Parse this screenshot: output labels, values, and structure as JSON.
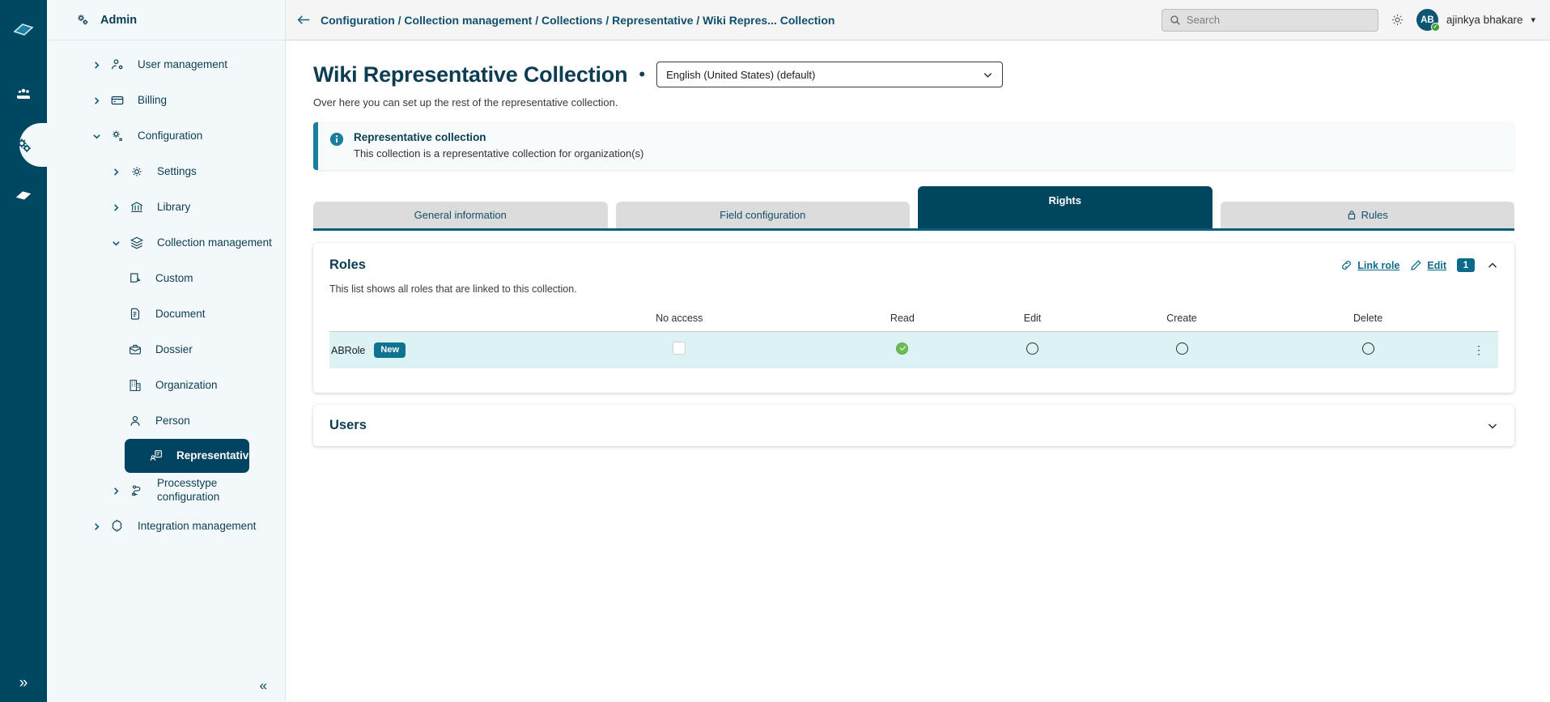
{
  "rail": {
    "logo_icon": "cloud-logo-icon",
    "items": [
      {
        "name": "users-rail-icon",
        "active": false
      },
      {
        "name": "configuration-rail-icon",
        "active": true
      },
      {
        "name": "integration-rail-icon",
        "active": false
      }
    ],
    "expand_icon": "double-chevron-right-icon"
  },
  "sidebar": {
    "title": "Admin",
    "title_icon": "admin-gears-icon",
    "collapse_icon": "double-chevron-left-icon",
    "items": [
      {
        "label": "User management",
        "icon": "user-settings-icon",
        "level": 0,
        "chevron": "right",
        "selected": false
      },
      {
        "label": "Billing",
        "icon": "credit-card-icon",
        "level": 0,
        "chevron": "right",
        "selected": false
      },
      {
        "label": "Configuration",
        "icon": "configuration-gear-icon",
        "level": 0,
        "chevron": "down",
        "selected": false
      },
      {
        "label": "Settings",
        "icon": "gear-icon",
        "level": 1,
        "chevron": "right",
        "selected": false
      },
      {
        "label": "Library",
        "icon": "library-bank-icon",
        "level": 1,
        "chevron": "right",
        "selected": false
      },
      {
        "label": "Collection management",
        "icon": "layers-icon",
        "level": 1,
        "chevron": "down",
        "selected": false
      },
      {
        "label": "Custom",
        "icon": "custom-pencil-page-icon",
        "level": 2,
        "chevron": "none",
        "selected": false
      },
      {
        "label": "Document",
        "icon": "document-icon",
        "level": 2,
        "chevron": "none",
        "selected": false
      },
      {
        "label": "Dossier",
        "icon": "briefcase-icon",
        "level": 2,
        "chevron": "none",
        "selected": false
      },
      {
        "label": "Organization",
        "icon": "building-icon",
        "level": 2,
        "chevron": "none",
        "selected": false
      },
      {
        "label": "Person",
        "icon": "person-icon",
        "level": 2,
        "chevron": "none",
        "selected": false
      },
      {
        "label": "Representative",
        "icon": "representative-icon",
        "level": 2,
        "chevron": "none",
        "selected": true
      },
      {
        "label": "Processtype configuration",
        "icon": "processtype-icon",
        "level": 2,
        "chevron": "right",
        "selected": false
      },
      {
        "label": "Integration management",
        "icon": "puzzle-icon",
        "level": 0,
        "chevron": "right",
        "selected": false
      }
    ]
  },
  "topbar": {
    "back_icon": "back-arrow-icon",
    "breadcrumb": "Configuration / Collection management / Collections / Representative / Wiki Repres... Collection",
    "search": {
      "placeholder": "Search",
      "value": "",
      "icon": "search-icon"
    },
    "gear_icon": "gear-icon",
    "user": {
      "initials": "AB",
      "name": "ajinkya bhakare",
      "status": "online",
      "caret_icon": "chevron-down-icon"
    }
  },
  "page": {
    "title": "Wiki Representative Collection",
    "separator": "•",
    "language": {
      "selected": "English (United States) (default)",
      "caret_icon": "chevron-down-icon"
    },
    "subtitle": "Over here you can set up the rest of the representative collection."
  },
  "banner": {
    "icon": "info-circle-icon",
    "title": "Representative collection",
    "text": "This collection is a representative collection for organization(s)",
    "accent_color": "#1a7f9c"
  },
  "tabs": [
    {
      "label": "General information",
      "active": false,
      "icon": null
    },
    {
      "label": "Field configuration",
      "active": false,
      "icon": null
    },
    {
      "label": "Rights",
      "active": true,
      "icon": null
    },
    {
      "label": "Rules",
      "active": false,
      "icon": "lock-icon"
    }
  ],
  "roles_card": {
    "title": "Roles",
    "description": "This list shows all roles that are linked to this collection.",
    "actions": {
      "link_role": {
        "label": "Link role",
        "icon": "link-icon"
      },
      "edit": {
        "label": "Edit",
        "icon": "pencil-icon"
      },
      "count": "1",
      "collapse_icon": "chevron-up-icon"
    },
    "columns": [
      "",
      "No access",
      "Read",
      "Edit",
      "Create",
      "Delete",
      ""
    ],
    "rows": [
      {
        "name": "ABRole",
        "badge": "New",
        "no_access": false,
        "read": true,
        "edit": false,
        "create": false,
        "delete": false,
        "menu_icon": "kebab-menu-icon"
      }
    ]
  },
  "users_card": {
    "title": "Users",
    "expand_icon": "chevron-down-icon"
  }
}
